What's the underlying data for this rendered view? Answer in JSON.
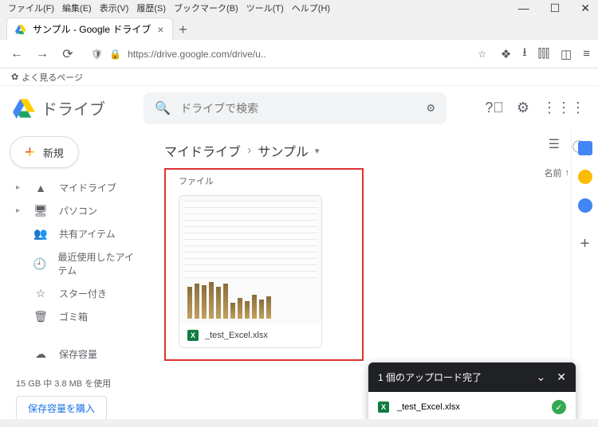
{
  "browser": {
    "menus": [
      "ファイル(F)",
      "編集(E)",
      "表示(V)",
      "履歴(S)",
      "ブックマーク(B)",
      "ツール(T)",
      "ヘルプ(H)"
    ],
    "tab_title": "サンプル - Google ドライブ",
    "url": "https://drive.google.com/drive/u..",
    "bookmark_label": "よく見るページ"
  },
  "header": {
    "app_name": "ドライブ",
    "search_placeholder": "ドライブで検索"
  },
  "sidebar": {
    "new_label": "新規",
    "items": [
      {
        "label": "マイドライブ",
        "has_caret": true
      },
      {
        "label": "パソコン",
        "has_caret": true
      },
      {
        "label": "共有アイテム",
        "has_caret": false
      },
      {
        "label": "最近使用したアイテム",
        "has_caret": false
      },
      {
        "label": "スター付き",
        "has_caret": false
      },
      {
        "label": "ゴミ箱",
        "has_caret": false
      }
    ],
    "storage_label": "保存容量",
    "storage_used": "15 GB 中 3.8 MB を使用",
    "buy_label": "保存容量を購入"
  },
  "main": {
    "breadcrumb_root": "マイドライブ",
    "breadcrumb_current": "サンプル",
    "section_files": "ファイル",
    "sort_label": "名前",
    "file_name": "_test_Excel.xlsx"
  },
  "toast": {
    "title": "1 個のアップロード完了",
    "file": "_test_Excel.xlsx"
  },
  "chart_data": {
    "type": "bar",
    "note": "small spreadsheet preview thumbnail with bar chart",
    "values": [
      40,
      44,
      42,
      46,
      40,
      44,
      20,
      26,
      22,
      30,
      24,
      28
    ]
  }
}
